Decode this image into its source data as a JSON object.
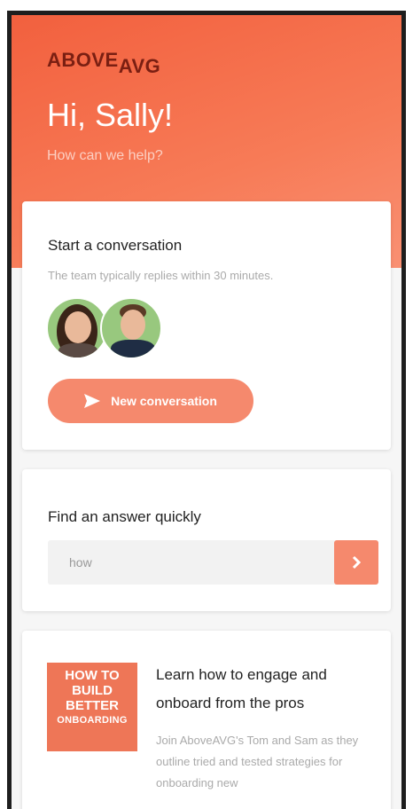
{
  "header": {
    "logo_main": "ABOVE",
    "logo_sub": "AVG",
    "greeting": "Hi, Sally!",
    "subtitle": "How can we help?"
  },
  "conversation": {
    "title": "Start a conversation",
    "subtitle": "The team typically replies within 30 minutes.",
    "button_label": "New conversation"
  },
  "search": {
    "title": "Find an answer quickly",
    "input_value": "how"
  },
  "article": {
    "thumb_lines": [
      "HOW TO",
      "BUILD",
      "BETTER",
      "ONBOARDING"
    ],
    "title": "Learn how to engage and onboard from the pros",
    "description": "Join AboveAVG's Tom and Sam as they outline tried and tested strategies for onboarding new"
  },
  "colors": {
    "accent": "#f5896d",
    "header_start": "#f2603e",
    "header_end": "#f99073",
    "logo": "#7a1f12"
  },
  "icons": [
    "send-icon",
    "chevron-right-icon"
  ]
}
